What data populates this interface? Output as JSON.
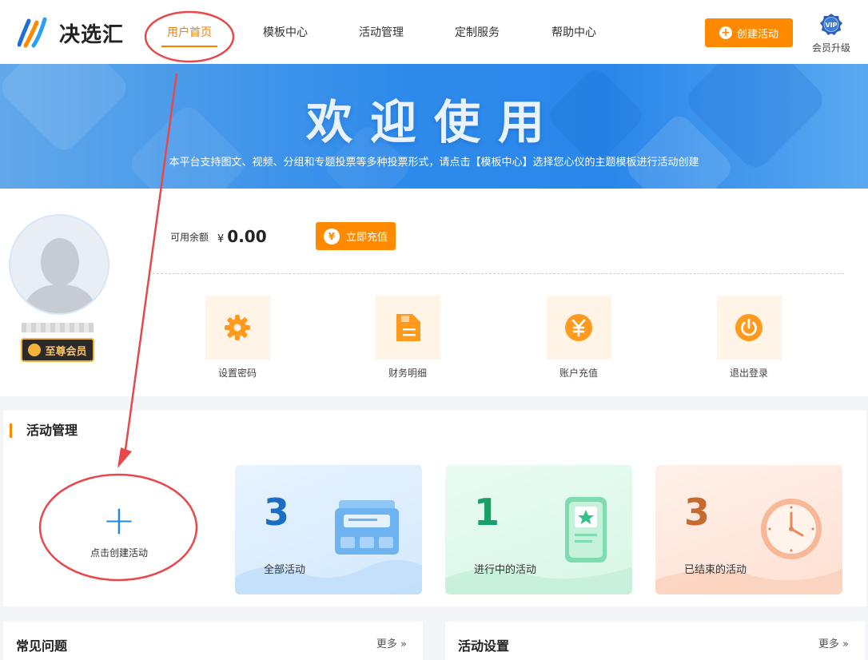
{
  "header": {
    "logo_text": "决选汇",
    "nav": [
      {
        "label": "用户首页",
        "active": true
      },
      {
        "label": "模板中心",
        "active": false
      },
      {
        "label": "活动管理",
        "active": false
      },
      {
        "label": "定制服务",
        "active": false
      },
      {
        "label": "帮助中心",
        "active": false
      }
    ],
    "create_button": "创建活动",
    "vip_badge": "VIP",
    "vip_label": "会员升级"
  },
  "banner": {
    "title": "欢迎使用",
    "subtitle": "本平台支持图文、视频、分组和专题投票等多种投票形式，请点击【模板中心】选择您心仪的主题模板进行活动创建"
  },
  "account": {
    "balance_label": "可用余额",
    "currency": "¥",
    "balance": "0.00",
    "recharge_button": "立即充值",
    "member_level": "至尊会员",
    "quick_actions": [
      {
        "label": "设置密码",
        "icon": "gear-icon"
      },
      {
        "label": "财务明细",
        "icon": "document-icon"
      },
      {
        "label": "账户充值",
        "icon": "yen-coin-icon"
      },
      {
        "label": "退出登录",
        "icon": "power-icon"
      }
    ]
  },
  "activity": {
    "title": "活动管理",
    "create_label": "点击创建活动",
    "stats": [
      {
        "count": "3",
        "label": "全部活动",
        "color": "#1a6fc4"
      },
      {
        "count": "1",
        "label": "进行中的活动",
        "color": "#18a06a"
      },
      {
        "count": "3",
        "label": "已结束的活动",
        "color": "#c8692e"
      }
    ]
  },
  "panels": {
    "faq_title": "常见问题",
    "faq_more": "更多",
    "settings_title": "活动设置",
    "settings_more": "更多"
  },
  "colors": {
    "accent": "#ff8a00",
    "annotation": "#e8474b",
    "banner_blue": "#2f8bea"
  }
}
